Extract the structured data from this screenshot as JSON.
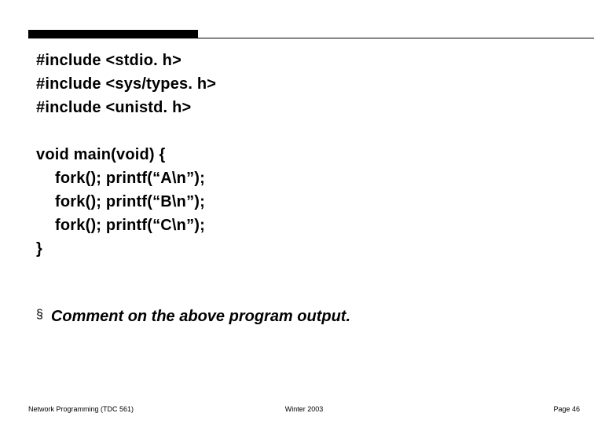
{
  "code": {
    "line1": "#include <stdio. h>",
    "line2": "#include <sys/types. h>",
    "line3": "#include <unistd. h>",
    "line4": "void main(void) {",
    "line5": "fork(); printf(“A\\n”);",
    "line6": "fork(); printf(“B\\n”);",
    "line7": "fork(); printf(“C\\n”);",
    "line8": "}"
  },
  "bullet": {
    "symbol": "§",
    "text": "Comment on the above program output."
  },
  "footer": {
    "left": "Network Programming (TDC 561)",
    "center": "Winter  2003",
    "right": "Page 46"
  }
}
